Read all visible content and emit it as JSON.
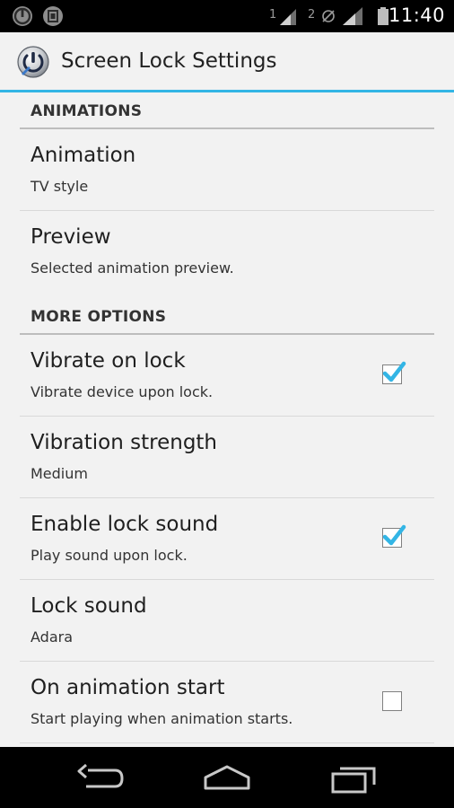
{
  "status_bar": {
    "sim1_label": "1",
    "sim2_label": "2",
    "time": "11:40",
    "left_icons": [
      "power-lock-icon",
      "screenshot-icon"
    ]
  },
  "app": {
    "title": "Screen Lock Settings",
    "accent_color": "#33b5e5",
    "icon": "power-lock-app-icon"
  },
  "sections": {
    "animations": {
      "header": "ANIMATIONS",
      "items": [
        {
          "title": "Animation",
          "summary": "TV style"
        },
        {
          "title": "Preview",
          "summary": "Selected animation preview."
        }
      ]
    },
    "more_options": {
      "header": "MORE OPTIONS",
      "items": [
        {
          "title": "Vibrate on lock",
          "summary": "Vibrate device upon lock.",
          "checked": true
        },
        {
          "title": "Vibration strength",
          "summary": "Medium"
        },
        {
          "title": "Enable lock sound",
          "summary": "Play sound upon lock.",
          "checked": true
        },
        {
          "title": "Lock sound",
          "summary": "Adara"
        },
        {
          "title": "On animation start",
          "summary": "Start playing when animation starts.",
          "checked": false
        }
      ]
    }
  },
  "nav_bar": {
    "buttons": [
      "back-icon",
      "home-icon",
      "recent-apps-icon"
    ]
  }
}
